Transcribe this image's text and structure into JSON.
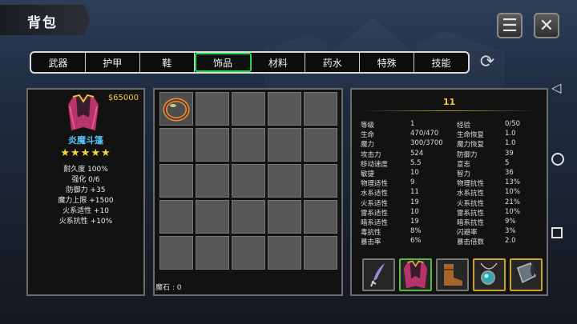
{
  "header": {
    "title": "背包"
  },
  "tabs": [
    {
      "label": "武器"
    },
    {
      "label": "护甲"
    },
    {
      "label": "鞋"
    },
    {
      "label": "饰品"
    },
    {
      "label": "材料"
    },
    {
      "label": "药水"
    },
    {
      "label": "特殊"
    },
    {
      "label": "技能"
    }
  ],
  "active_tab": "饰品",
  "item_detail": {
    "price": "$65000",
    "name": "炎魔斗篷",
    "stars": "★★★★★",
    "stats": [
      "耐久度 100%",
      "强化 0/6",
      "防御力 +35",
      "魔力上限 +1500",
      "火系适性 +10",
      "火系抗性 +10%"
    ]
  },
  "inventory": {
    "mana_stone": "魔石 : 0"
  },
  "character": {
    "level": "11",
    "stats": [
      {
        "l1": "等级",
        "v1": "1",
        "l2": "经验",
        "v2": "0/50"
      },
      {
        "l1": "生命",
        "v1": "470/470",
        "l2": "生命恢复",
        "v2": "1.0"
      },
      {
        "l1": "魔力",
        "v1": "300/3700",
        "l2": "魔力恢复",
        "v2": "1.0"
      },
      {
        "l1": "攻击力",
        "v1": "524",
        "l2": "防御力",
        "v2": "39"
      },
      {
        "l1": "移动速度",
        "v1": "5.5",
        "l2": "意志",
        "v2": "5"
      },
      {
        "l1": "敏捷",
        "v1": "10",
        "l2": "智力",
        "v2": "36"
      },
      {
        "l1": "物理适性",
        "v1": "9",
        "l2": "物理抗性",
        "v2": "13%"
      },
      {
        "l1": "水系适性",
        "v1": "11",
        "l2": "水系抗性",
        "v2": "10%"
      },
      {
        "l1": "火系适性",
        "v1": "19",
        "l2": "火系抗性",
        "v2": "21%"
      },
      {
        "l1": "雷系适性",
        "v1": "10",
        "l2": "雷系抗性",
        "v2": "10%"
      },
      {
        "l1": "暗系适性",
        "v1": "19",
        "l2": "暗系抗性",
        "v2": "9%"
      },
      {
        "l1": "毒抗性",
        "v1": "8%",
        "l2": "闪避率",
        "v2": "3%"
      },
      {
        "l1": "暴击率",
        "v1": "6%",
        "l2": "暴击倍数",
        "v2": "2.0"
      }
    ]
  },
  "equipment_icons": [
    "dagger-icon",
    "cloak-icon",
    "boots-icon",
    "amulet-icon",
    "bracer-icon"
  ],
  "colors": {
    "active_tab": "#27d94a",
    "price": "#f2c93d",
    "item_name": "#56c2f2",
    "stars": "#f4d23a"
  }
}
